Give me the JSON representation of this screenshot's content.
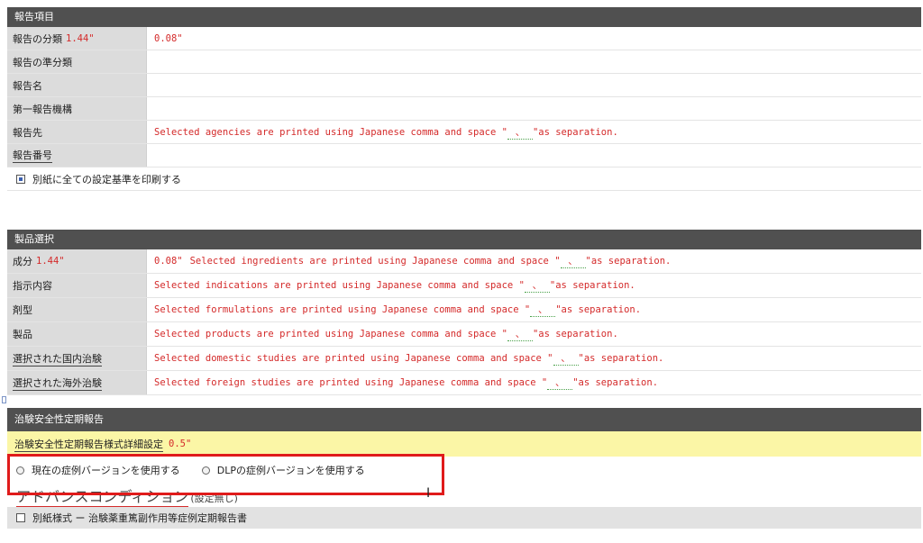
{
  "report_items": {
    "header": "報告項目",
    "rows": [
      {
        "label": "報告の分類",
        "label_suffix": "1.44\"",
        "value": "0.08\""
      },
      {
        "label": "報告の準分類",
        "label_suffix": "",
        "value": ""
      },
      {
        "label": "報告名",
        "label_suffix": "",
        "value": ""
      },
      {
        "label": "第一報告機構",
        "label_suffix": "",
        "value": ""
      },
      {
        "label": "報告先",
        "label_suffix": "",
        "value_prefix": "Selected agencies are printed using Japanese comma and space \"",
        "value_sep": "、 ",
        "value_suffix": "\"as separation."
      },
      {
        "label": "報告番号",
        "label_suffix": "",
        "value": ""
      }
    ],
    "checkbox_label": "別紙に全ての設定基準を印刷する",
    "checkbox_checked": true
  },
  "product_selection": {
    "header": "製品選択",
    "rows": [
      {
        "label": "成分",
        "label_suffix": "1.44\"",
        "value_lead": "0.08\"",
        "value_prefix": "Selected ingredients are printed using Japanese comma and space \"",
        "value_sep": "、 ",
        "value_suffix": "\"as separation."
      },
      {
        "label": "指示内容",
        "label_suffix": "",
        "value_lead": "",
        "value_prefix": "Selected indications are printed using Japanese comma and space \"",
        "value_sep": "、 ",
        "value_suffix": "\"as separation."
      },
      {
        "label": "剤型",
        "label_suffix": "",
        "value_lead": "",
        "value_prefix": "Selected formulations are printed using Japanese comma and space \"",
        "value_sep": "、 ",
        "value_suffix": "\"as separation."
      },
      {
        "label": "製品",
        "label_suffix": "",
        "value_lead": "",
        "value_prefix": "Selected products are printed using Japanese comma and space \"",
        "value_sep": "、 ",
        "value_suffix": "\"as separation."
      },
      {
        "label": "選択された国内治験",
        "label_suffix": "",
        "value_lead": "",
        "value_prefix": "Selected domestic studies are printed using Japanese comma and space \"",
        "value_sep": "、 ",
        "value_suffix": "\"as separation."
      },
      {
        "label": "選択された海外治験",
        "label_suffix": "",
        "value_lead": "",
        "value_prefix": "Selected foreign studies are printed using Japanese comma and space \"",
        "value_sep": "、 ",
        "value_suffix": "\"as separation."
      }
    ]
  },
  "safety_report": {
    "header": "治験安全性定期報告",
    "detail_label": "治験安全性定期報告様式詳細設定",
    "detail_value": "0.5\"",
    "radio_options": [
      {
        "label": "現在の症例バージョンを使用する"
      },
      {
        "label": "DLPの症例バージョンを使用する"
      }
    ],
    "advanced_title": "アドバンスコンディション",
    "advanced_subtitle": "(設定無し)",
    "appendix_label": "別紙様式 ー 治験薬重篤副作用等症例定期報告書"
  },
  "colors": {
    "header_bg": "#505050",
    "label_bg": "#dcdcdc",
    "note_red": "#d42a2a",
    "highlight_yellow": "#fbf6a6",
    "callout_red": "#e01b1b"
  },
  "icons": {
    "checkbox": "checkbox-checked-icon",
    "radio": "radio-icon",
    "cursor": "text-cursor-icon"
  }
}
